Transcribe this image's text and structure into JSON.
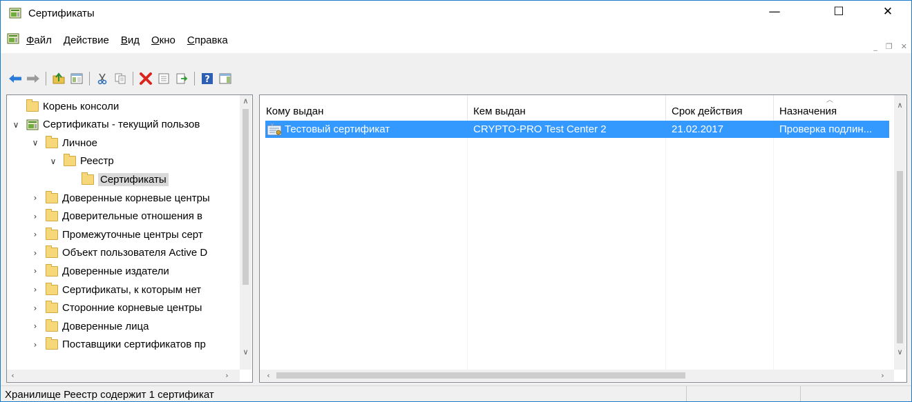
{
  "window": {
    "title": "Сертификаты",
    "minimize_glyph": "—",
    "maximize_glyph": "☐",
    "close_glyph": "✕"
  },
  "menu": {
    "items": [
      {
        "accel": "Ф",
        "rest": "айл"
      },
      {
        "accel": "Д",
        "rest": "ействие"
      },
      {
        "accel": "В",
        "rest": "ид"
      },
      {
        "accel": "О",
        "rest": "кно"
      },
      {
        "accel": "С",
        "rest": "правка"
      }
    ],
    "mdi_minimize": "_",
    "mdi_restore": "❐",
    "mdi_close": "✕"
  },
  "toolbar": {
    "icons": [
      "back-arrow-icon",
      "forward-arrow-icon",
      "up-folder-icon",
      "show-hide-tree-icon",
      "cut-icon",
      "copy-icon",
      "delete-icon",
      "properties-icon",
      "export-list-icon",
      "help-icon",
      "show-hide-action-pane-icon"
    ]
  },
  "tree": {
    "items": [
      {
        "label": "Корень консоли",
        "expander": "",
        "icon": "folder"
      },
      {
        "label": "Сертификаты - текущий пользов",
        "expander": "∨",
        "icon": "snapin"
      },
      {
        "label": "Личное",
        "expander": "∨",
        "icon": "folder"
      },
      {
        "label": "Реестр",
        "expander": "∨",
        "icon": "folder"
      },
      {
        "label": "Сертификаты",
        "expander": "",
        "icon": "folder"
      },
      {
        "label": "Доверенные корневые центры",
        "expander": "›",
        "icon": "folder"
      },
      {
        "label": "Доверительные отношения в",
        "expander": "›",
        "icon": "folder"
      },
      {
        "label": "Промежуточные центры серт",
        "expander": "›",
        "icon": "folder"
      },
      {
        "label": "Объект пользователя Active D",
        "expander": "›",
        "icon": "folder"
      },
      {
        "label": "Доверенные издатели",
        "expander": "›",
        "icon": "folder"
      },
      {
        "label": "Сертификаты, к которым нет",
        "expander": "›",
        "icon": "folder"
      },
      {
        "label": "Сторонние корневые центры",
        "expander": "›",
        "icon": "folder"
      },
      {
        "label": "Доверенные лица",
        "expander": "›",
        "icon": "folder"
      },
      {
        "label": "Поставщики сертификатов пр",
        "expander": "›",
        "icon": "folder"
      }
    ],
    "selected_index": 4
  },
  "list": {
    "columns": [
      "Кому выдан",
      "Кем выдан",
      "Срок действия",
      "Назначения"
    ],
    "rows": [
      [
        "Тестовый сертификат",
        "CRYPTO-PRO Test Center 2",
        "21.02.2017",
        "Проверка подлин..."
      ]
    ],
    "selected_row": 0,
    "selection_color": "#3399ff"
  },
  "status": {
    "text": "Хранилище Реестр содержит 1 сертификат"
  }
}
